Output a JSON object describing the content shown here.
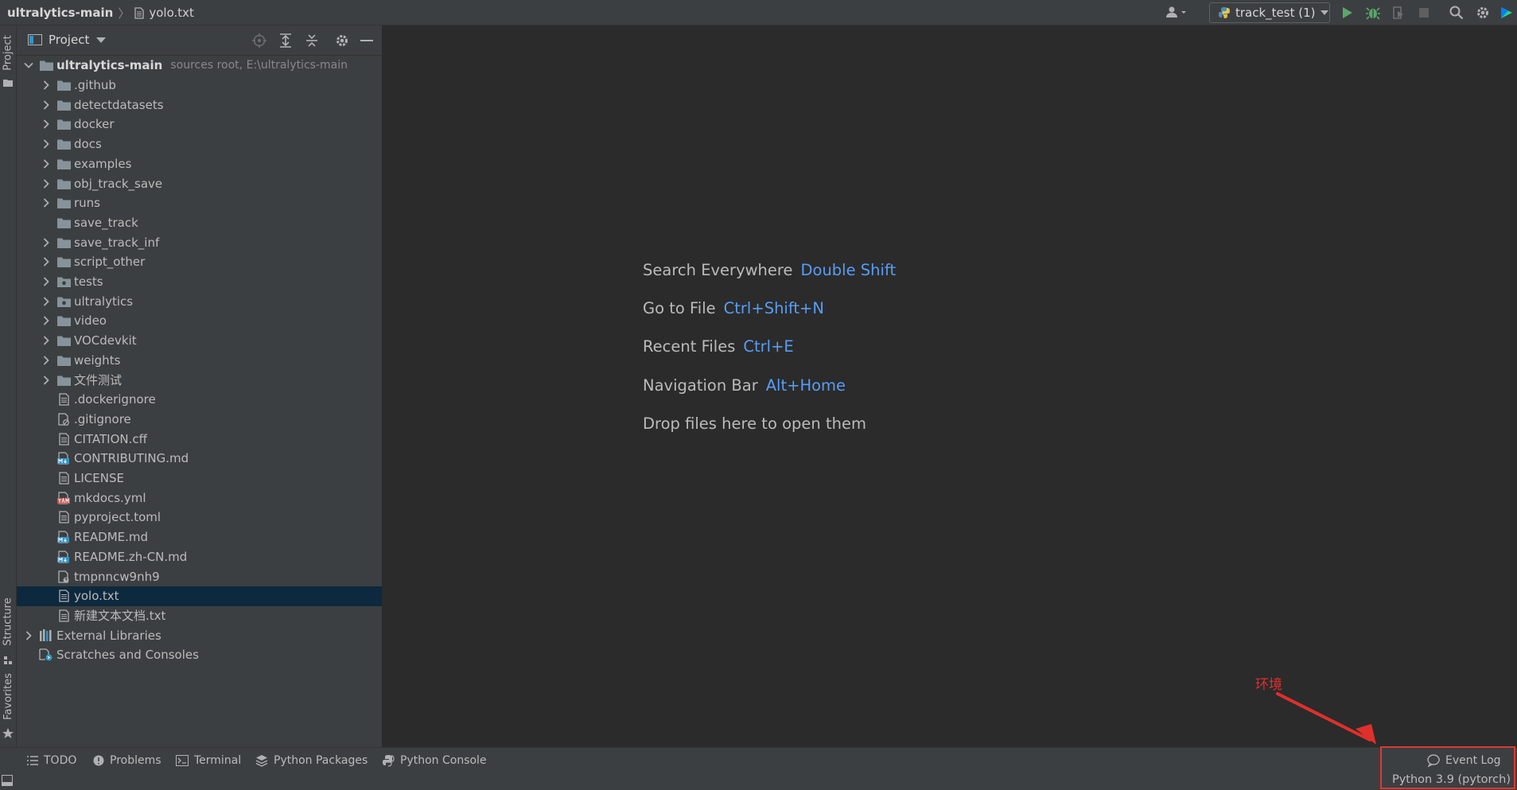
{
  "titlebar": {
    "project_name": "ultralytics-main",
    "separator": "〉",
    "file_name": "yolo.txt",
    "run_config": "track_test (1)"
  },
  "side_tabs": {
    "project": "Project",
    "structure": "Structure",
    "favorites": "Favorites"
  },
  "project_panel": {
    "title": "Project",
    "tree": [
      {
        "label": "ultralytics-main",
        "sub": "sources root,  E:\\ultralytics-main",
        "icon": "folder-icon",
        "depth": 0,
        "expand": "open",
        "bold": true
      },
      {
        "label": ".github",
        "icon": "folder-icon",
        "depth": 1,
        "expand": "closed"
      },
      {
        "label": "detectdatasets",
        "icon": "folder-icon",
        "depth": 1,
        "expand": "closed"
      },
      {
        "label": "docker",
        "icon": "folder-icon",
        "depth": 1,
        "expand": "closed"
      },
      {
        "label": "docs",
        "icon": "folder-icon",
        "depth": 1,
        "expand": "closed"
      },
      {
        "label": "examples",
        "icon": "folder-icon",
        "depth": 1,
        "expand": "closed"
      },
      {
        "label": "obj_track_save",
        "icon": "folder-icon",
        "depth": 1,
        "expand": "closed"
      },
      {
        "label": "runs",
        "icon": "folder-icon",
        "depth": 1,
        "expand": "closed"
      },
      {
        "label": "save_track",
        "icon": "folder-icon",
        "depth": 1,
        "expand": "none"
      },
      {
        "label": "save_track_inf",
        "icon": "folder-icon",
        "depth": 1,
        "expand": "closed"
      },
      {
        "label": "script_other",
        "icon": "folder-icon",
        "depth": 1,
        "expand": "closed"
      },
      {
        "label": "tests",
        "icon": "package-folder-icon",
        "depth": 1,
        "expand": "closed"
      },
      {
        "label": "ultralytics",
        "icon": "package-folder-icon",
        "depth": 1,
        "expand": "closed"
      },
      {
        "label": "video",
        "icon": "folder-icon",
        "depth": 1,
        "expand": "closed"
      },
      {
        "label": "VOCdevkit",
        "icon": "folder-icon",
        "depth": 1,
        "expand": "closed"
      },
      {
        "label": "weights",
        "icon": "folder-icon",
        "depth": 1,
        "expand": "closed"
      },
      {
        "label": "文件测试",
        "icon": "folder-icon",
        "depth": 1,
        "expand": "closed"
      },
      {
        "label": ".dockerignore",
        "icon": "text-file-icon",
        "depth": 1,
        "expand": "none"
      },
      {
        "label": ".gitignore",
        "icon": "ignore-file-icon",
        "depth": 1,
        "expand": "none"
      },
      {
        "label": "CITATION.cff",
        "icon": "text-file-icon",
        "depth": 1,
        "expand": "none"
      },
      {
        "label": "CONTRIBUTING.md",
        "icon": "markdown-file-icon",
        "depth": 1,
        "expand": "none"
      },
      {
        "label": "LICENSE",
        "icon": "text-file-icon",
        "depth": 1,
        "expand": "none"
      },
      {
        "label": "mkdocs.yml",
        "icon": "yaml-file-icon",
        "depth": 1,
        "expand": "none"
      },
      {
        "label": "pyproject.toml",
        "icon": "text-file-icon",
        "depth": 1,
        "expand": "none"
      },
      {
        "label": "README.md",
        "icon": "markdown-file-icon",
        "depth": 1,
        "expand": "none"
      },
      {
        "label": "README.zh-CN.md",
        "icon": "markdown-file-icon",
        "depth": 1,
        "expand": "none"
      },
      {
        "label": "tmpnncw9nh9",
        "icon": "unknown-file-icon",
        "depth": 1,
        "expand": "none"
      },
      {
        "label": "yolo.txt",
        "icon": "text-file-icon",
        "depth": 1,
        "expand": "none",
        "selected": true
      },
      {
        "label": "新建文本文档.txt",
        "icon": "text-file-icon",
        "depth": 1,
        "expand": "none"
      },
      {
        "label": "External Libraries",
        "icon": "libraries-icon",
        "depth": 0,
        "expand": "closed"
      },
      {
        "label": "Scratches and Consoles",
        "icon": "scratches-icon",
        "depth": 0,
        "expand": "none"
      }
    ]
  },
  "editor": {
    "hints": [
      {
        "label": "Search Everywhere",
        "key": "Double Shift"
      },
      {
        "label": "Go to File",
        "key": "Ctrl+Shift+N"
      },
      {
        "label": "Recent Files",
        "key": "Ctrl+E"
      },
      {
        "label": "Navigation Bar",
        "key": "Alt+Home"
      },
      {
        "label": "Drop files here to open them",
        "key": ""
      }
    ]
  },
  "annotation": {
    "text": "环境",
    "color": "#e0302c"
  },
  "bottom_tabs": [
    {
      "label": "TODO",
      "icon": "todo-list-icon"
    },
    {
      "label": "Problems",
      "icon": "problems-icon"
    },
    {
      "label": "Terminal",
      "icon": "terminal-icon"
    },
    {
      "label": "Python Packages",
      "icon": "packages-icon"
    },
    {
      "label": "Python Console",
      "icon": "python-console-icon"
    }
  ],
  "event_log": "Event Log",
  "status": {
    "interpreter": "Python 3.9 (pytorch)"
  },
  "colors": {
    "accent_key": "#589df6",
    "selection": "#0d293e",
    "run_green": "#59a869",
    "folder_blue": "#87939a"
  }
}
